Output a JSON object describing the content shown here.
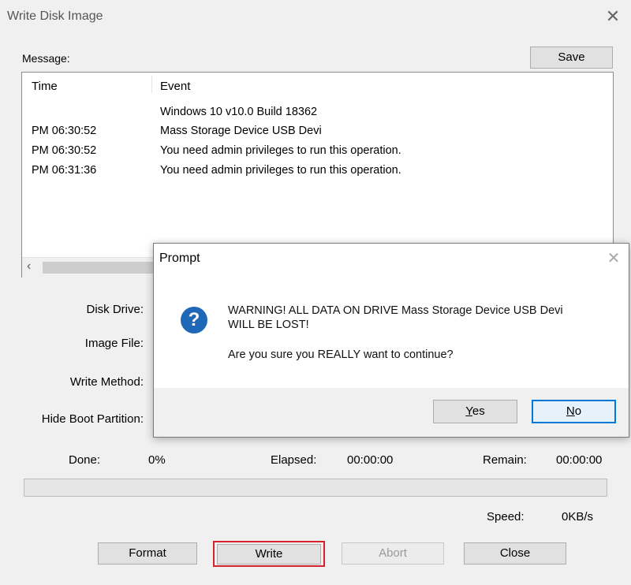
{
  "window": {
    "title": "Write Disk Image",
    "close_glyph": "✕"
  },
  "message_label": "Message:",
  "save_button": "Save",
  "log": {
    "headers": {
      "time": "Time",
      "event": "Event"
    },
    "rows": [
      {
        "time": "",
        "event": "Windows 10 v10.0 Build 18362"
      },
      {
        "time": "PM 06:30:52",
        "event": "Mass Storage Device USB Devi"
      },
      {
        "time": "PM 06:30:52",
        "event": "You need admin privileges to run this operation."
      },
      {
        "time": "PM 06:31:36",
        "event": "You need admin privileges to run this operation."
      }
    ],
    "scroll_left_glyph": "‹"
  },
  "fields": {
    "disk_drive": "Disk Drive:",
    "image_file": "Image File:",
    "write_method": "Write Method:",
    "hide_boot_partition": "Hide Boot Partition:"
  },
  "status": {
    "done_label": "Done:",
    "done_value": "0%",
    "elapsed_label": "Elapsed:",
    "elapsed_value": "00:00:00",
    "remain_label": "Remain:",
    "remain_value": "00:00:00",
    "speed_label": "Speed:",
    "speed_value": "0KB/s",
    "progress_fraction": 0
  },
  "buttons": {
    "format": "Format",
    "write": "Write",
    "abort": "Abort",
    "close": "Close"
  },
  "dialog": {
    "title": "Prompt",
    "close_glyph": "✕",
    "icon_glyph": "?",
    "warning_line1": "WARNING! ALL DATA ON DRIVE Mass Storage Device USB Devi",
    "warning_line2": "WILL BE LOST!",
    "question": "Are you sure you REALLY want to continue?",
    "yes_prefix": "Y",
    "yes_rest": "es",
    "no_prefix": "N",
    "no_rest": "o"
  },
  "colors": {
    "highlight": "#d6222f",
    "question_icon": "#1f68b8"
  }
}
